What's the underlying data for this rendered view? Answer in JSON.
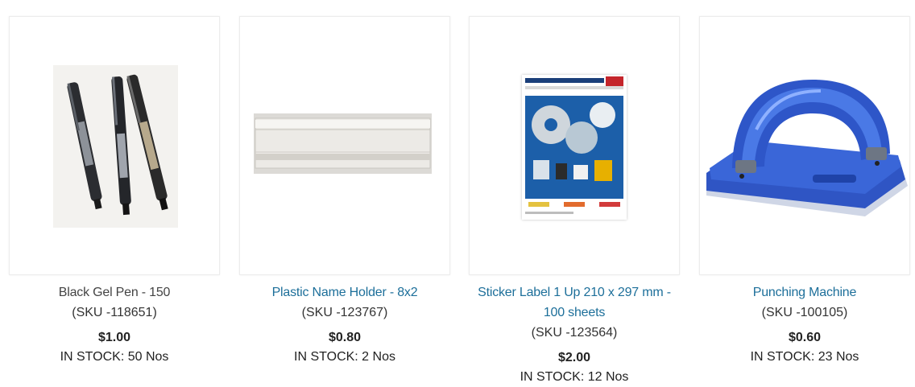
{
  "products": [
    {
      "title": "Black Gel Pen - 150",
      "sku": "(SKU -118651)",
      "price": "$1.00",
      "stock": "IN STOCK: 50 Nos",
      "image_icon": "gel-pens-image"
    },
    {
      "title": "Plastic Name Holder - 8x2",
      "sku": "(SKU -123767)",
      "price": "$0.80",
      "stock": "IN STOCK: 2 Nos",
      "image_icon": "name-holder-image"
    },
    {
      "title": "Sticker Label 1 Up 210 x 297 mm - 100 sheets",
      "sku": "(SKU -123564)",
      "price": "$2.00",
      "stock": "IN STOCK: 12 Nos",
      "image_icon": "sticker-label-pack-image"
    },
    {
      "title": "Punching Machine",
      "sku": "(SKU -100105)",
      "price": "$0.60",
      "stock": "IN STOCK: 23 Nos",
      "image_icon": "punching-machine-image"
    }
  ],
  "colors": {
    "link": "#1d6f9a",
    "text": "#333333",
    "border": "#ececec"
  }
}
